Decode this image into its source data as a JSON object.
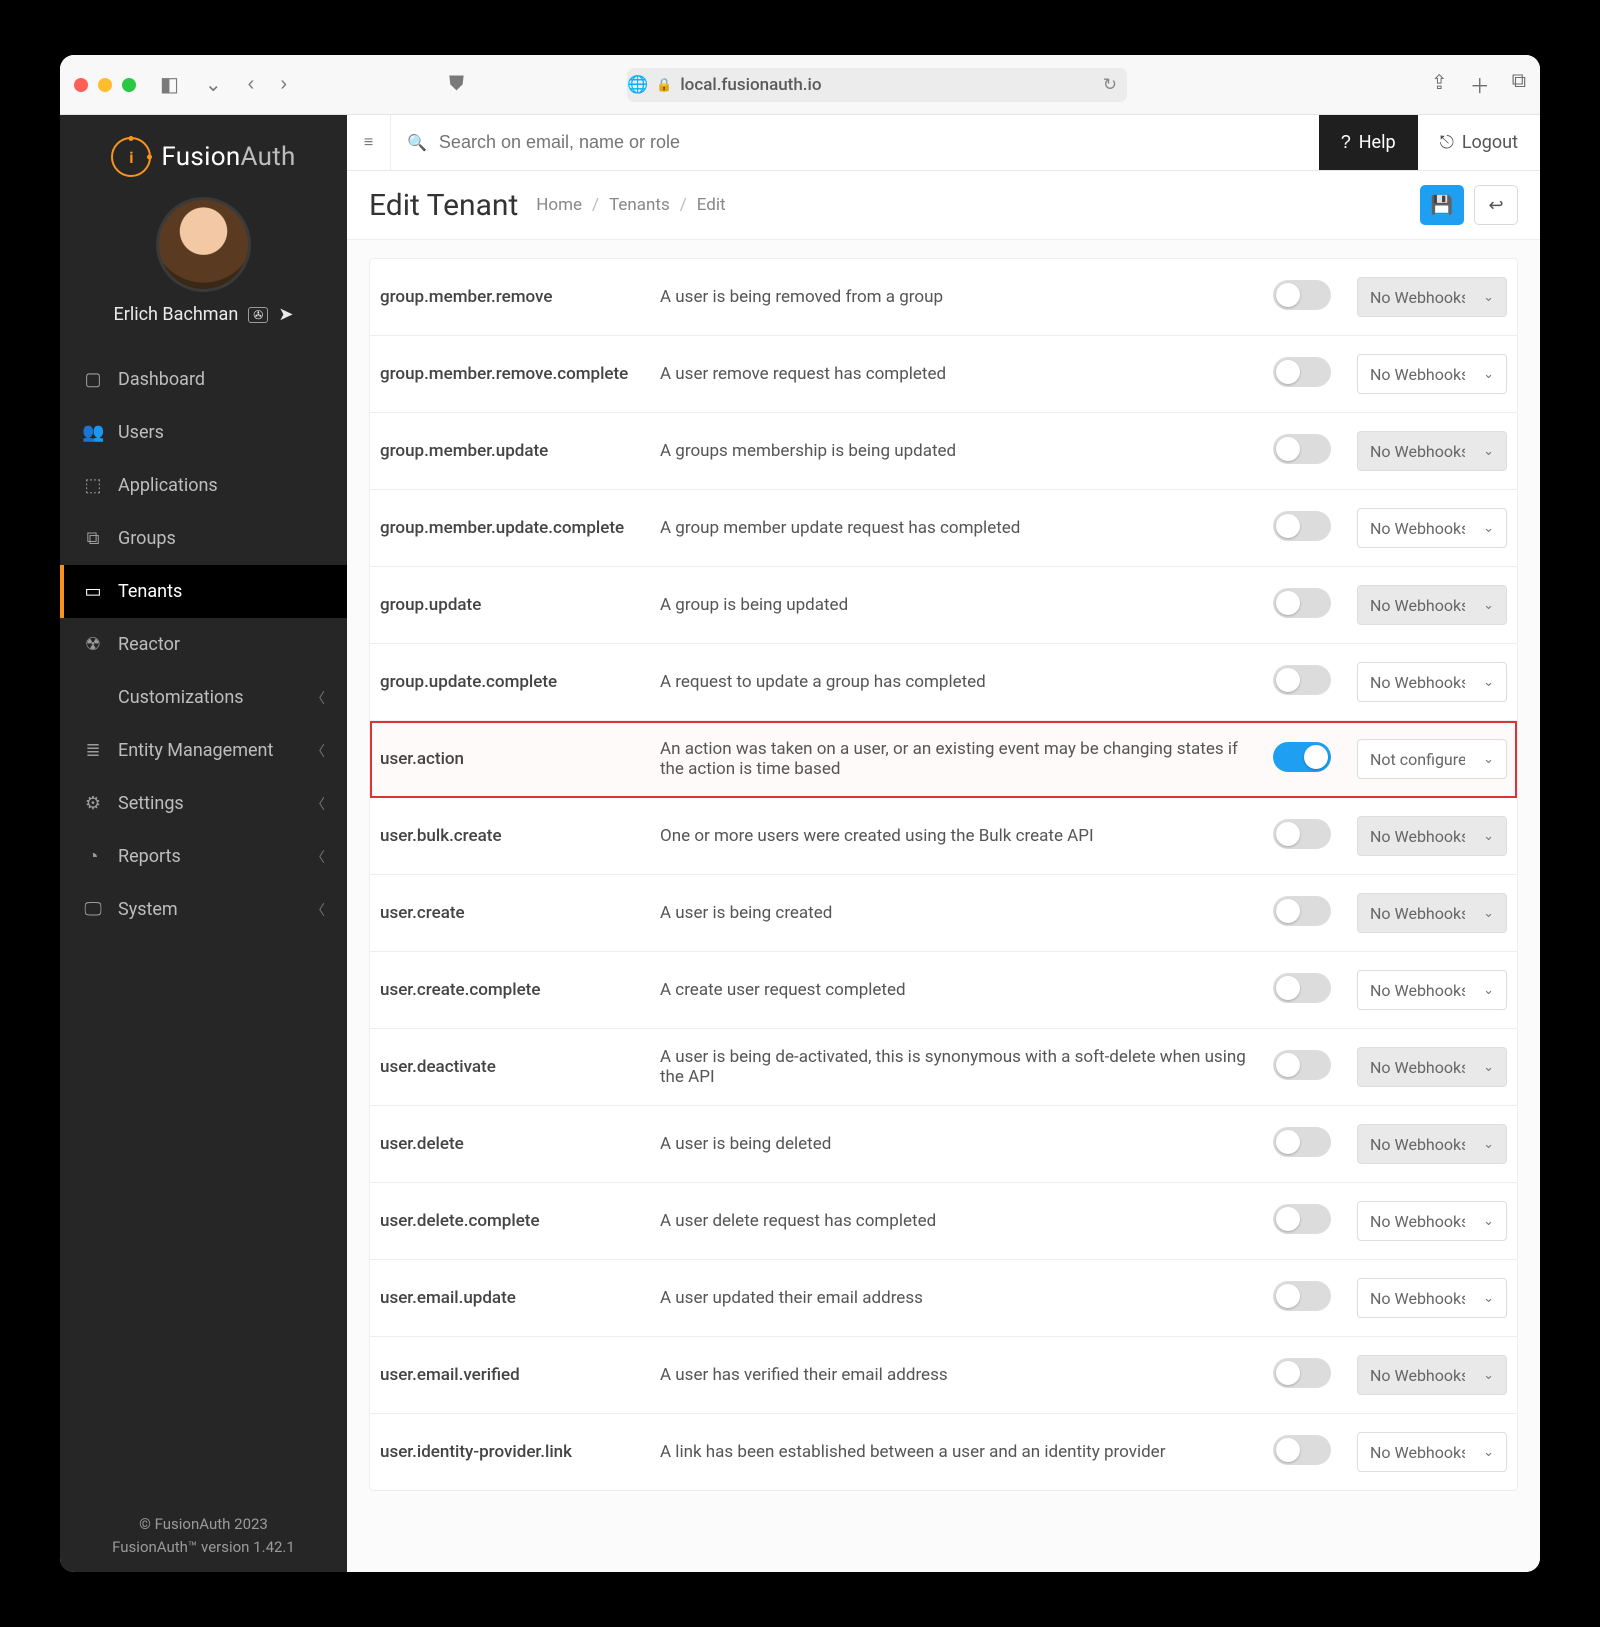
{
  "browser": {
    "host": "local.fusionauth.io"
  },
  "brand": {
    "name1": "Fusion",
    "name2": "Auth"
  },
  "user": {
    "name": "Erlich Bachman"
  },
  "sidebar": {
    "items": [
      {
        "label": "Dashboard",
        "icon": "▢"
      },
      {
        "label": "Users",
        "icon": "👥"
      },
      {
        "label": "Applications",
        "icon": "⬚"
      },
      {
        "label": "Groups",
        "icon": "⧉"
      },
      {
        "label": "Tenants",
        "icon": "▭",
        "active": true
      },
      {
        "label": "Reactor",
        "icon": "☢"
      },
      {
        "label": "Customizations",
        "icon": "</>",
        "caret": true
      },
      {
        "label": "Entity Management",
        "icon": "≣",
        "caret": true
      },
      {
        "label": "Settings",
        "icon": "⚙",
        "caret": true
      },
      {
        "label": "Reports",
        "icon": "◔",
        "caret": true
      },
      {
        "label": "System",
        "icon": "🖵",
        "caret": true
      }
    ],
    "footer1": "© FusionAuth 2023",
    "footer2": "FusionAuth™ version 1.42.1"
  },
  "topbar": {
    "search_placeholder": "Search on email, name or role",
    "help": "Help",
    "logout": "Logout"
  },
  "header": {
    "title": "Edit Tenant",
    "crumbs": [
      "Home",
      "Tenants",
      "Edit"
    ]
  },
  "selectDefault": "No Webhooks",
  "rows": [
    {
      "name": "group.member.remove",
      "desc": "A user is being removed from a group",
      "on": false,
      "shaded": true
    },
    {
      "name": "group.member.remove.complete",
      "desc": "A user remove request has completed",
      "on": false,
      "shaded": false
    },
    {
      "name": "group.member.update",
      "desc": "A groups membership is being updated",
      "on": false,
      "shaded": true
    },
    {
      "name": "group.member.update.complete",
      "desc": "A group member update request has completed",
      "on": false,
      "shaded": false
    },
    {
      "name": "group.update",
      "desc": "A group is being updated",
      "on": false,
      "shaded": true
    },
    {
      "name": "group.update.complete",
      "desc": "A request to update a group has completed",
      "on": false,
      "shaded": false
    },
    {
      "name": "user.action",
      "desc": "An action was taken on a user, or an existing event may be changing states if the action is time based",
      "on": true,
      "shaded": false,
      "highlight": true,
      "selectLabel": "Not configured"
    },
    {
      "name": "user.bulk.create",
      "desc": "One or more users were created using the Bulk create API",
      "on": false,
      "shaded": true
    },
    {
      "name": "user.create",
      "desc": "A user is being created",
      "on": false,
      "shaded": true
    },
    {
      "name": "user.create.complete",
      "desc": "A create user request completed",
      "on": false,
      "shaded": false
    },
    {
      "name": "user.deactivate",
      "desc": "A user is being de-activated, this is synonymous with a soft-delete when using the API",
      "on": false,
      "shaded": true
    },
    {
      "name": "user.delete",
      "desc": "A user is being deleted",
      "on": false,
      "shaded": true
    },
    {
      "name": "user.delete.complete",
      "desc": "A user delete request has completed",
      "on": false,
      "shaded": false
    },
    {
      "name": "user.email.update",
      "desc": "A user updated their email address",
      "on": false,
      "shaded": false
    },
    {
      "name": "user.email.verified",
      "desc": "A user has verified their email address",
      "on": false,
      "shaded": true
    },
    {
      "name": "user.identity-provider.link",
      "desc": "A link has been established between a user and an identity provider",
      "on": false,
      "shaded": false
    }
  ]
}
